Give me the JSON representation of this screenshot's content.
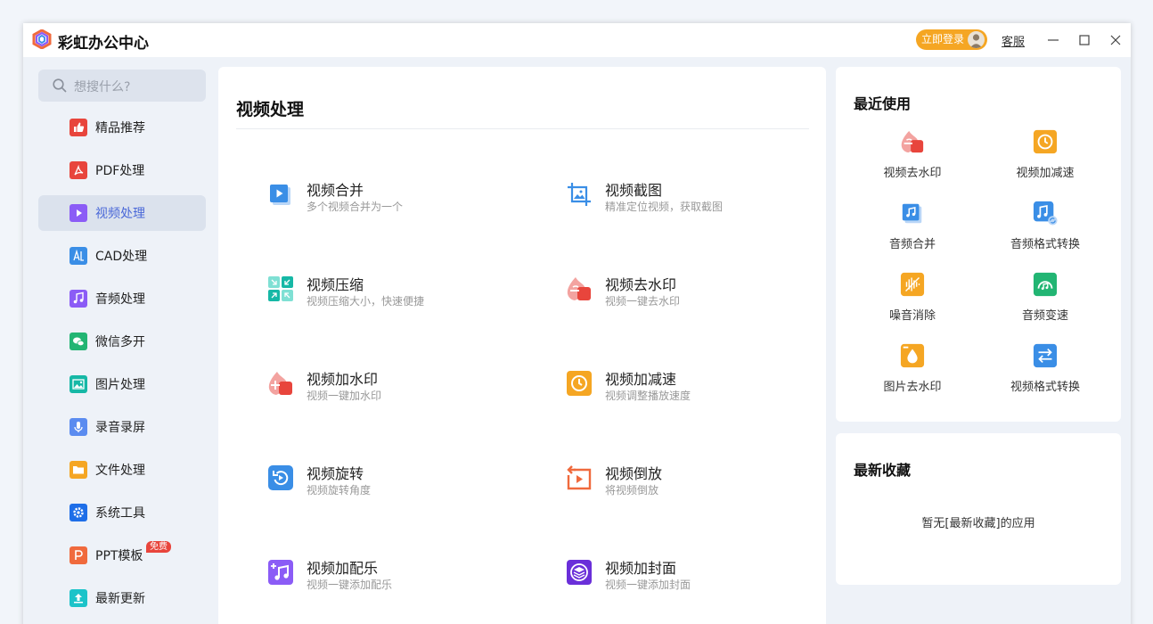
{
  "app": {
    "title": "彩虹办公中心"
  },
  "header": {
    "login_label": "立即登录",
    "service_label": "客服"
  },
  "search": {
    "placeholder": "想搜什么?"
  },
  "sidebar": {
    "items": [
      {
        "label": "精品推荐",
        "icon": "thumbs-up-icon",
        "color": "#e8453c"
      },
      {
        "label": "PDF处理",
        "icon": "pdf-icon",
        "color": "#e8453c"
      },
      {
        "label": "视频处理",
        "icon": "video-play-icon",
        "color": "#8b5cf6",
        "active": true
      },
      {
        "label": "CAD处理",
        "icon": "cad-icon",
        "color": "#3a8ee6"
      },
      {
        "label": "音频处理",
        "icon": "music-note-icon",
        "color": "#8b5cf6"
      },
      {
        "label": "微信多开",
        "icon": "wechat-icon",
        "color": "#22b573"
      },
      {
        "label": "图片处理",
        "icon": "image-icon",
        "color": "#16b8a6"
      },
      {
        "label": "录音录屏",
        "icon": "microphone-icon",
        "color": "#5b8cf0"
      },
      {
        "label": "文件处理",
        "icon": "folder-icon",
        "color": "#f5a623"
      },
      {
        "label": "系统工具",
        "icon": "gear-icon",
        "color": "#1e6ee8"
      },
      {
        "label": "PPT模板",
        "icon": "ppt-icon",
        "color": "#f06a3d",
        "badge": "免费"
      },
      {
        "label": "最新更新",
        "icon": "upload-icon",
        "color": "#1cc3c9"
      }
    ]
  },
  "main": {
    "title": "视频处理",
    "tools": [
      {
        "title": "视频合并",
        "desc": "多个视频合并为一个",
        "icon": "video-merge-icon"
      },
      {
        "title": "视频截图",
        "desc": "精准定位视频，获取截图",
        "icon": "video-crop-icon"
      },
      {
        "title": "视频压缩",
        "desc": "视频压缩大小，快速便捷",
        "icon": "video-compress-icon"
      },
      {
        "title": "视频去水印",
        "desc": "视频一键去水印",
        "icon": "remove-watermark-icon"
      },
      {
        "title": "视频加水印",
        "desc": "视频一键加水印",
        "icon": "add-watermark-icon"
      },
      {
        "title": "视频加减速",
        "desc": "视频调整播放速度",
        "icon": "speed-icon"
      },
      {
        "title": "视频旋转",
        "desc": "视频旋转角度",
        "icon": "rotate-icon"
      },
      {
        "title": "视频倒放",
        "desc": "将视频倒放",
        "icon": "reverse-icon"
      },
      {
        "title": "视频加配乐",
        "desc": "视频一键添加配乐",
        "icon": "add-music-icon"
      },
      {
        "title": "视频加封面",
        "desc": "视频一键添加封面",
        "icon": "add-cover-icon"
      }
    ]
  },
  "recent": {
    "title": "最近使用",
    "items": [
      {
        "label": "视频去水印",
        "icon": "remove-watermark-icon"
      },
      {
        "label": "视频加减速",
        "icon": "speed-icon"
      },
      {
        "label": "音频合并",
        "icon": "audio-merge-icon"
      },
      {
        "label": "音频格式转换",
        "icon": "audio-convert-icon"
      },
      {
        "label": "噪音消除",
        "icon": "noise-removal-icon"
      },
      {
        "label": "音频变速",
        "icon": "audio-speed-icon"
      },
      {
        "label": "图片去水印",
        "icon": "image-watermark-icon"
      },
      {
        "label": "视频格式转换",
        "icon": "video-convert-icon"
      }
    ]
  },
  "favorites": {
    "title": "最新收藏",
    "empty_text": "暂无[最新收藏]的应用"
  }
}
